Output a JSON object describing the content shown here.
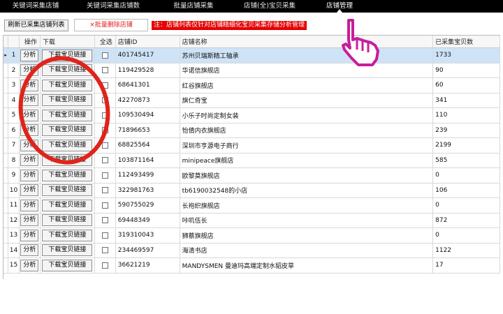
{
  "tabs": [
    {
      "label": "关键词采集店铺",
      "active": false
    },
    {
      "label": "关键词采集店铺数",
      "active": false
    },
    {
      "label": "批量店铺采集",
      "active": false
    },
    {
      "label": "店铺(全)宝贝采集",
      "active": false
    },
    {
      "label": "店铺管理",
      "active": true
    }
  ],
  "toolbar": {
    "refresh_label": "刷新已采集店铺列表",
    "batch_delete_label": "×批量删除店铺",
    "notice": "注：店铺列表仅针对店铺精细化宝贝采集存储分析管理"
  },
  "table": {
    "headers": [
      "操作",
      "下载",
      "全选",
      "店铺ID",
      "店铺名称",
      "已采集宝贝数"
    ],
    "analyze_label": "分析",
    "download_label": "下载宝贝链接",
    "selected_row_marker": "▸",
    "rows": [
      {
        "num": "1",
        "id": "401745417",
        "name": "苏州贝瑞斯精工轴承",
        "count": "1733"
      },
      {
        "num": "2",
        "id": "119429528",
        "name": "华诺信旗舰店",
        "count": "90"
      },
      {
        "num": "3",
        "id": "68641301",
        "name": "红谷旗舰店",
        "count": "60"
      },
      {
        "num": "4",
        "id": "42270873",
        "name": "旗仁奇宝",
        "count": "341"
      },
      {
        "num": "5",
        "id": "109530494",
        "name": "小乐子时尚定制女装",
        "count": "110"
      },
      {
        "num": "6",
        "id": "71896653",
        "name": "怡倩内衣旗舰店",
        "count": "239"
      },
      {
        "num": "7",
        "id": "68825564",
        "name": "深圳市亨源电子商行",
        "count": "2199"
      },
      {
        "num": "8",
        "id": "103871164",
        "name": "minipeace旗舰店",
        "count": "585"
      },
      {
        "num": "9",
        "id": "112493499",
        "name": "欧黎莫旗舰店",
        "count": "0"
      },
      {
        "num": "10",
        "id": "322981763",
        "name": "tb6190032548的小店",
        "count": "106"
      },
      {
        "num": "11",
        "id": "590755029",
        "name": "长袍织旗舰店",
        "count": "0"
      },
      {
        "num": "12",
        "id": "69448349",
        "name": "咔叽伍长",
        "count": "872"
      },
      {
        "num": "13",
        "id": "319310043",
        "name": "狮蔡旗舰店",
        "count": "0"
      },
      {
        "num": "14",
        "id": "234469597",
        "name": "海清书店",
        "count": "1122"
      },
      {
        "num": "15",
        "id": "36621219",
        "name": "MANDYSMEN 曼迪玛高端定制水貂皮草",
        "count": "17"
      }
    ]
  },
  "colors": {
    "tabbar_bg": "#000000",
    "notice_bg": "#e40000",
    "selected_row": "#cfe3f7",
    "annotation_red": "#e0241b",
    "hand_magenta": "#c81e9a"
  }
}
